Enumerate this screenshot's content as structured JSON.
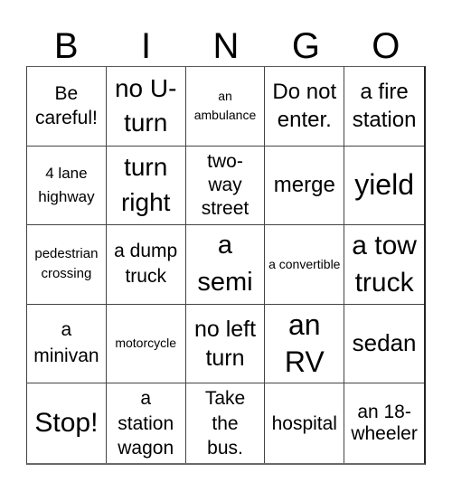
{
  "header": {
    "letters": [
      "B",
      "I",
      "N",
      "G",
      "O"
    ]
  },
  "cells": [
    "Be careful!",
    "no U-turn",
    "an ambulance",
    "Do not enter.",
    "a fire station",
    "4 lane highway",
    "turn right",
    "two-way street",
    "merge",
    "yield",
    "pedestrian crossing",
    "a dump truck",
    "a semi",
    "a convertible",
    "a tow truck",
    "a minivan",
    "motorcycle",
    "no left turn",
    "an RV",
    "sedan",
    "Stop!",
    "a station wagon",
    "Take the bus.",
    "hospital",
    "an 18-wheeler"
  ]
}
